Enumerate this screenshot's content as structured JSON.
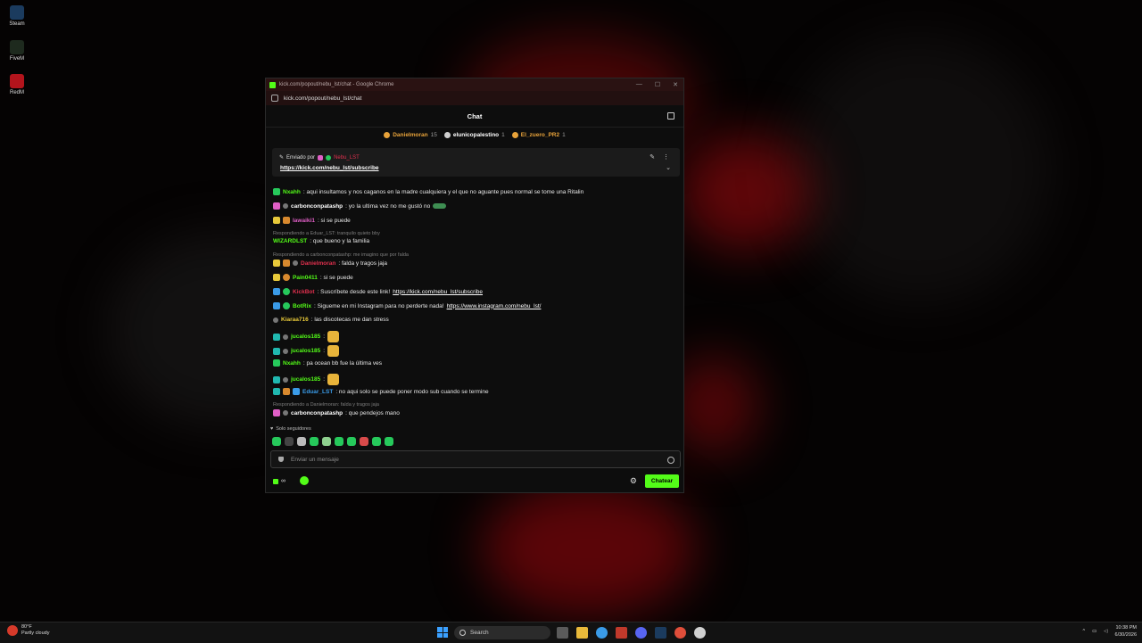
{
  "desktop": {
    "icons": [
      {
        "label": "Steam"
      },
      {
        "label": "FiveM"
      },
      {
        "label": "RedM"
      }
    ]
  },
  "window": {
    "title": "kick.com/popout/nebu_lst/chat - Google Chrome",
    "url": "kick.com/popout/nebu_lst/chat",
    "controls": {
      "minimize": "—",
      "maximize": "☐",
      "close": "✕"
    }
  },
  "chat": {
    "header": "Chat",
    "gifters": [
      {
        "name": "Danielmoran",
        "count": "15",
        "color": "#e8a33a"
      },
      {
        "name": "elunicopalestino",
        "count": "1",
        "color": "#ffffff"
      },
      {
        "name": "El_zuero_PR2",
        "count": "1",
        "color": "#e8a33a"
      }
    ],
    "pinned": {
      "sent_by": "Enviado por",
      "name": "Nebu_LST",
      "link": "https://kick.com/nebu_lst/subscribe"
    },
    "messages": [
      {
        "name": "Nxahh",
        "name_color": "#53fc18",
        "text": ": aqui insultamos y nos caganos en la madre cualquiera y el que no aguante pues normal se tome una Ritalin"
      },
      {
        "name": "carbonconpatashp",
        "name_color": "#ffffff",
        "text": ": yo la ultima vez no me gustó no"
      },
      {
        "name": "lawaiki1",
        "name_color": "#e05fc6",
        "text": ": si se puede"
      },
      {
        "reply": "Respondiendo a Eduar_LST: tranquilo quieto bby",
        "name": "WIZARDLST",
        "name_color": "#53fc18",
        "text": ": que bueno y la familia"
      },
      {
        "reply": "Respondiendo a carbonconpatashp: me imagino que por falda",
        "name": "Danielmoran",
        "name_color": "#e0304e",
        "text": ": falda y tragos jaja"
      },
      {
        "name": "Pain0411",
        "name_color": "#53fc18",
        "text": ": si se puede"
      },
      {
        "name": "KickBot",
        "name_color": "#e0304e",
        "text": ": Suscríbete desde este link! ",
        "link": "https://kick.com/nebu_lst/subscribe"
      },
      {
        "name": "BotRix",
        "name_color": "#53fc18",
        "text": ": Sigueme en mi Instagram para no perderte nada! ",
        "link": "https://www.instagram.com/nebu_lst/"
      },
      {
        "name": "Kiaraa716",
        "name_color": "#e8c93a",
        "text": ": las discotecas me dan stress"
      },
      {
        "name": "jucalos185",
        "name_color": "#53fc18",
        "text": ":"
      },
      {
        "name": "jucalos185",
        "name_color": "#53fc18",
        "text": ":"
      },
      {
        "name": "Nxahh",
        "name_color": "#53fc18",
        "text": ": pa ocean bb fue la última ves"
      },
      {
        "name": "jucalos185",
        "name_color": "#53fc18",
        "text": ":"
      },
      {
        "name": "Eduar_LST",
        "name_color": "#3a9be8",
        "text": ": no aqui solo se puede poner modo sub cuando se termine"
      },
      {
        "reply": "Respondiendo a Danielmoran: falda y tragos jaja",
        "name": "carbonconpatashp",
        "name_color": "#ffffff",
        "text": ": que pendejos mano"
      }
    ],
    "followers_only": "Solo seguidores",
    "input_placeholder": "Enviar un mensaje",
    "points": "∞",
    "send_label": "Chatear"
  },
  "taskbar": {
    "weather_temp": "80°F",
    "weather_desc": "Partly cloudy",
    "search": "Search",
    "time": "10:38 PM",
    "date": "6/30/2026"
  }
}
